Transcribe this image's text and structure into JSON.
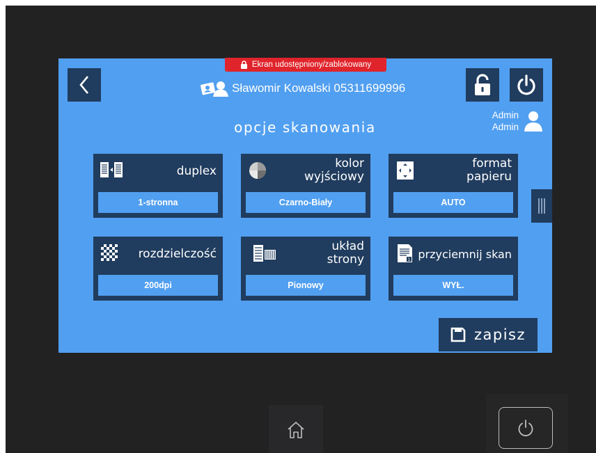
{
  "header": {
    "lock_banner": "Ekran udostępniony/zablokowany",
    "user_info": "Sławomir Kowalski 05311699996",
    "admin_line1": "Admin",
    "admin_line2": "Admin"
  },
  "title": "opcje skanowania",
  "tiles": [
    {
      "label": "duplex",
      "value": "1-stronna",
      "icon": "duplex-icon"
    },
    {
      "label": "kolor\nwyjściowy",
      "value": "Czarno-Biały",
      "icon": "color-output-icon"
    },
    {
      "label": "format\npapieru",
      "value": "AUTO",
      "icon": "paper-format-icon"
    },
    {
      "label": "rozdzielczość",
      "value": "200dpi",
      "icon": "resolution-icon"
    },
    {
      "label": "układ\nstrony",
      "value": "Pionowy",
      "icon": "page-layout-icon"
    },
    {
      "label": "przyciemnij skan",
      "value": "WYŁ.",
      "icon": "darken-scan-icon"
    }
  ],
  "save_label": "zapisz",
  "colors": {
    "screen": "#519ff0",
    "tile": "#203c5e",
    "banner": "#e0242b",
    "device": "#222223"
  }
}
